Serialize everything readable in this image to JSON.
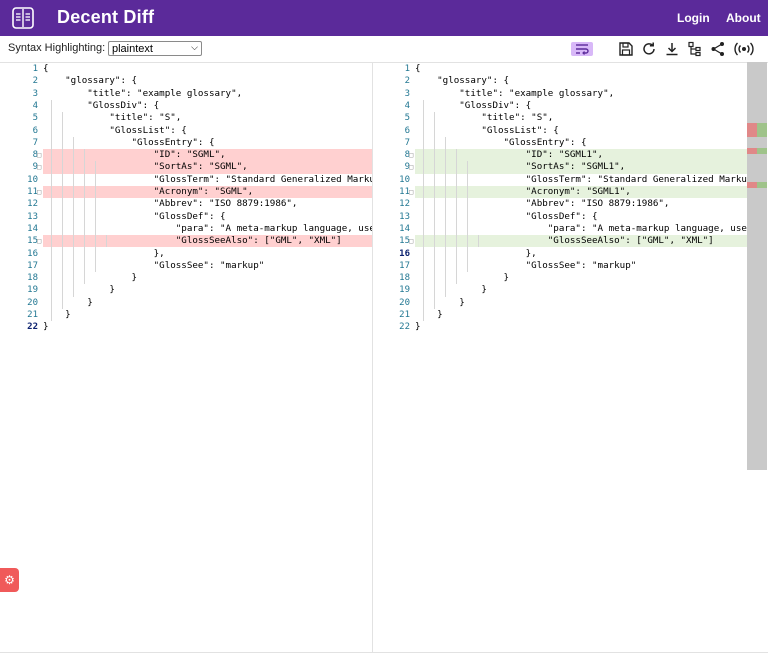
{
  "header": {
    "app_title": "Decent Diff",
    "nav": {
      "login": "Login",
      "about": "About"
    },
    "bg_color": "#5b2a9a"
  },
  "toolbar": {
    "syntax_label": "Syntax Highlighting:",
    "syntax_value": "plaintext",
    "buttons": [
      "word-wrap-icon",
      "save-icon",
      "refresh-icon",
      "download-icon",
      "tree-icon",
      "share-icon",
      "broadcast-icon"
    ]
  },
  "editor": {
    "line_numbers": [
      "1",
      "2",
      "3",
      "4",
      "5",
      "6",
      "7",
      "8",
      "9",
      "10",
      "11",
      "12",
      "13",
      "14",
      "15",
      "16",
      "17",
      "18",
      "19",
      "20",
      "21",
      "22"
    ],
    "left_lines": [
      "{",
      "    \"glossary\": {",
      "        \"title\": \"example glossary\",",
      "        \"GlossDiv\": {",
      "            \"title\": \"S\",",
      "            \"GlossList\": {",
      "                \"GlossEntry\": {",
      "                    \"ID\": \"SGML\",",
      "                    \"SortAs\": \"SGML\",",
      "                    \"GlossTerm\": \"Standard Generalized Markup Lang",
      "                    \"Acronym\": \"SGML\",",
      "                    \"Abbrev\": \"ISO 8879:1986\",",
      "                    \"GlossDef\": {",
      "                        \"para\": \"A meta-markup language, used to c",
      "                        \"GlossSeeAlso\": [\"GML\", \"XML\"]",
      "                    },",
      "                    \"GlossSee\": \"markup\"",
      "                }",
      "            }",
      "        }",
      "    }",
      "}"
    ],
    "right_lines": [
      "{",
      "    \"glossary\": {",
      "        \"title\": \"example glossary\",",
      "        \"GlossDiv\": {",
      "            \"title\": \"S\",",
      "            \"GlossList\": {",
      "                \"GlossEntry\": {",
      "                    \"ID\": \"SGML1\",",
      "                    \"SortAs\": \"SGML1\",",
      "                    \"GlossTerm\": \"Standard Generalized Markup Languag",
      "                    \"Acronym\": \"SGML1\",",
      "                    \"Abbrev\": \"ISO 8879:1986\",",
      "                    \"GlossDef\": {",
      "                        \"para\": \"A meta-markup language, used to cre",
      "                        \"GlossSeeAlso\": [\"GML\", \"XML\"]",
      "                    },",
      "                    \"GlossSee\": \"markup\"",
      "                }",
      "            }",
      "        }",
      "    }",
      "}"
    ],
    "changed_lines": [
      8,
      9,
      11,
      15
    ],
    "deleted_color": "#ffd0d0",
    "added_color": "#e6f2dd"
  },
  "fab": {
    "icon": "settings-icon",
    "color": "#f05a5a"
  }
}
